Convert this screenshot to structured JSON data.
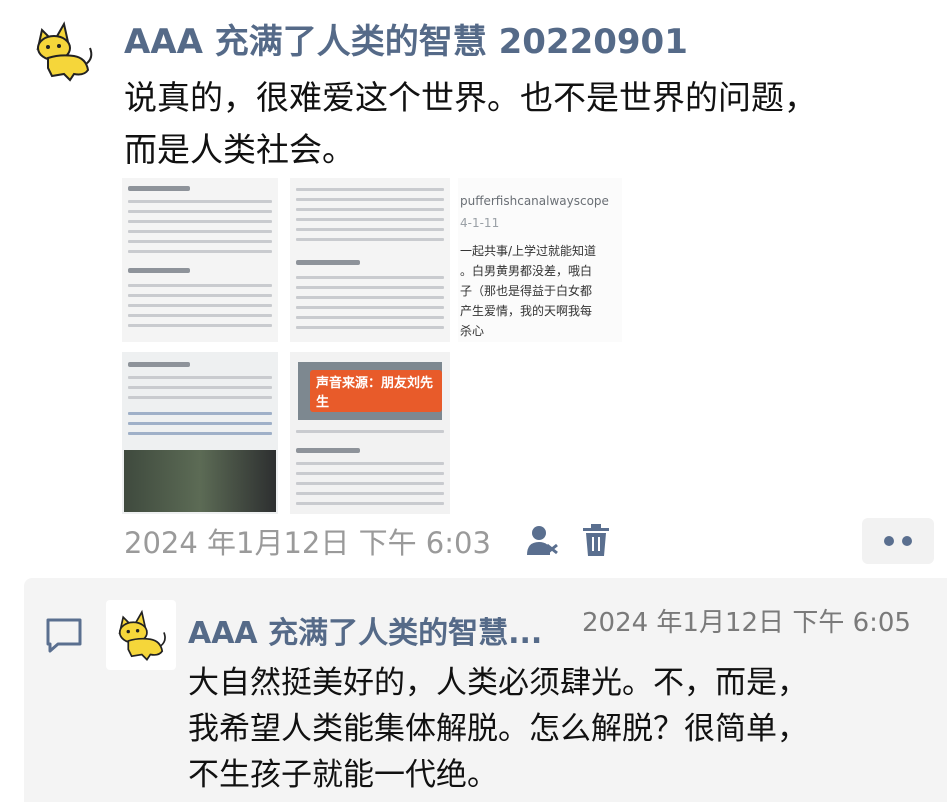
{
  "post": {
    "author": "AAA 充满了人类的智慧 20220901",
    "text_line1": "说真的，很难爱这个世界。也不是世界的问题，",
    "text_line2": "而是人类社会。",
    "timestamp": "2024 年1月12日 下午 6:03",
    "avatar_icon": "cat-icon",
    "images": {
      "t3_head": "pufferfishcanalwayscope",
      "t3_date": "4-1-11",
      "t3_lines": [
        "一起共事/上学过就能知道",
        "。白男黄男都没差，哦白",
        "子（那也是得益于白女都",
        "产生爱情，我的天啊我每",
        "杀心"
      ],
      "banner": "声音来源：朋友刘先生"
    },
    "actions": {
      "like_icon": "person-icon",
      "delete_icon": "trash-icon",
      "more_icon": "more-dots-icon"
    }
  },
  "comment": {
    "icon": "comment-icon",
    "author": "AAA 充满了人类的智慧...",
    "time": "2024 年1月12日 下午 6:05",
    "text_line1": "大自然挺美好的，人类必须肆光。不，而是，",
    "text_line2": "我希望人类能集体解脱。怎么解脱？很简单，",
    "text_line3": "不生孩子就能一代绝。"
  },
  "colors": {
    "author": "#556a88",
    "timestamp": "#9a9a9a",
    "comment_bg": "#f4f4f4",
    "cat_yellow": "#f5d63a"
  }
}
